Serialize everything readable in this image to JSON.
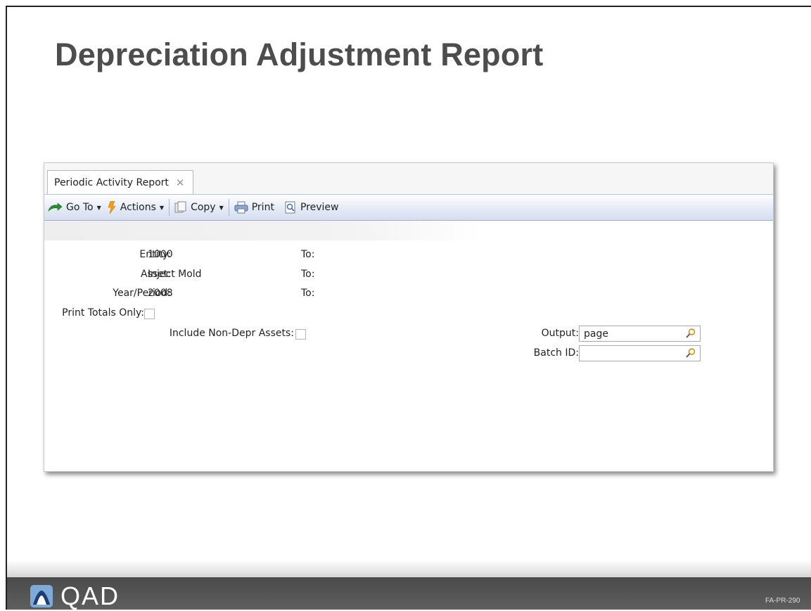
{
  "slide": {
    "title": "Depreciation Adjustment Report",
    "code": "FA-PR-290"
  },
  "window": {
    "tab_label": "Periodic Activity Report",
    "tab_close_icon": "close-icon"
  },
  "toolbar": {
    "goto_label": "Go To",
    "actions_label": "Actions",
    "copy_label": "Copy",
    "print_label": "Print",
    "preview_label": "Preview"
  },
  "form": {
    "entity_label": "Entity:",
    "entity_value": "1000",
    "asset_label": "Asset:",
    "asset_value": "Inject Mold",
    "year_period_label": "Year/Period:",
    "year_period_value": "2008",
    "to_label": "To:",
    "print_totals_label": "Print Totals Only:",
    "include_non_depr_label": "Include Non-Depr Assets:",
    "output_label": "Output:",
    "output_value": "page",
    "batch_id_label": "Batch ID:",
    "batch_id_value": ""
  },
  "footer": {
    "logo_text": "QAD"
  },
  "colors": {
    "title": "#4d4d4d",
    "toolbar_accent": "#d4ddef",
    "footer": "#4a4a4a"
  }
}
